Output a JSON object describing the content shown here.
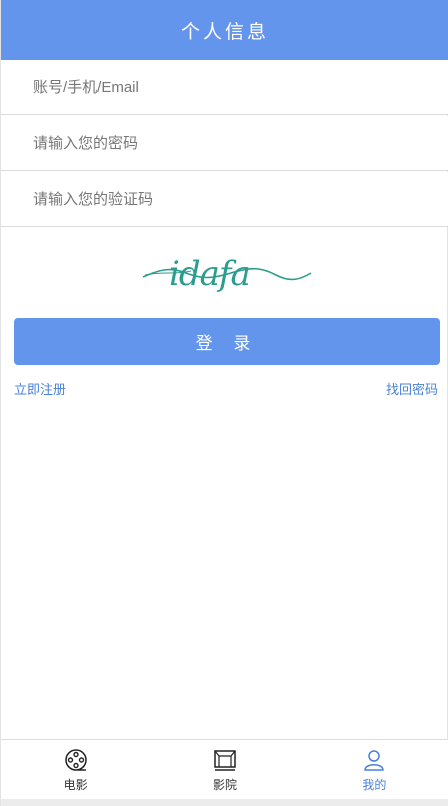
{
  "header": {
    "title": "个人信息"
  },
  "form": {
    "account_placeholder": "账号/手机/Email",
    "password_placeholder": "请输入您的密码",
    "code_placeholder": "请输入您的验证码"
  },
  "captcha": {
    "text": "idafa",
    "color": "#2a9d8f"
  },
  "login_label": "登 录",
  "links": {
    "register": "立即注册",
    "forgot": "找回密码"
  },
  "tabbar": {
    "tabs": [
      {
        "label": "电影",
        "icon": "film-reel-icon"
      },
      {
        "label": "影院",
        "icon": "cinema-screen-icon"
      },
      {
        "label": "我的",
        "icon": "user-icon",
        "active": true
      }
    ]
  },
  "colors": {
    "accent": "#6495ed",
    "link": "#4a80d9"
  }
}
